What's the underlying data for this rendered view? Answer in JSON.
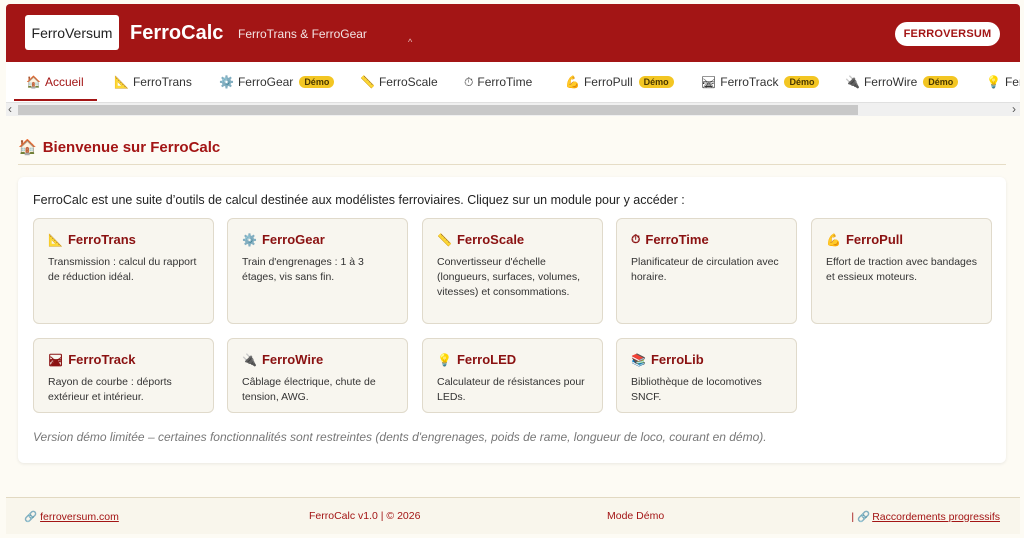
{
  "header": {
    "logo_text": "FerroVersum",
    "app_title": "FerroCalc",
    "subtitle": "FerroTrans & FerroGear",
    "caret": "^",
    "brand_button": "FERROVERSUM",
    "accent": "#a31515"
  },
  "tabs": [
    {
      "icon": "🏠",
      "icon_name": "house-icon",
      "label": "Accueil",
      "active": true,
      "badge": ""
    },
    {
      "icon": "📐",
      "icon_name": "triangle-ruler-icon",
      "label": "FerroTrans",
      "badge": ""
    },
    {
      "icon": "⚙️",
      "icon_name": "gear-icon",
      "label": "FerroGear",
      "badge": "Démo"
    },
    {
      "icon": "📏",
      "icon_name": "ruler-icon",
      "label": "FerroScale",
      "badge": ""
    },
    {
      "icon": "⏱",
      "icon_name": "stopwatch-icon",
      "label": "FerroTime",
      "badge": ""
    },
    {
      "icon": "💪",
      "icon_name": "flexed-arm-icon",
      "label": "FerroPull",
      "badge": "Démo"
    },
    {
      "icon": "🛤",
      "icon_name": "railway-track-icon",
      "label": "FerroTrack",
      "badge": "Démo"
    },
    {
      "icon": "🔌",
      "icon_name": "plug-icon",
      "label": "FerroWire",
      "badge": "Démo"
    },
    {
      "icon": "💡",
      "icon_name": "bulb-icon",
      "label": "Ferr",
      "badge": ""
    }
  ],
  "scrollbar": {
    "left_arrow": "‹",
    "right_arrow": "›"
  },
  "main": {
    "section_icon": "🏠",
    "section_title": "Bienvenue sur FerroCalc",
    "intro": "FerroCalc est une suite d’outils de calcul destinée aux modélistes ferroviaires. Cliquez sur un module pour y accéder :",
    "cards": [
      {
        "icon": "📐",
        "icon_name": "triangle-ruler-icon",
        "title": "FerroTrans",
        "desc": "Transmission : calcul du rapport de réduction idéal."
      },
      {
        "icon": "⚙️",
        "icon_name": "gear-icon",
        "title": "FerroGear",
        "desc": "Train d'engrenages : 1 à 3 étages, vis sans fin."
      },
      {
        "icon": "📏",
        "icon_name": "ruler-icon",
        "title": "FerroScale",
        "desc": "Convertisseur d'échelle (longueurs, surfaces, volumes, vitesses) et consommations."
      },
      {
        "icon": "⏱",
        "icon_name": "stopwatch-icon",
        "title": "FerroTime",
        "desc": "Planificateur de circulation avec horaire."
      },
      {
        "icon": "💪",
        "icon_name": "flexed-arm-icon",
        "title": "FerroPull",
        "desc": "Effort de traction avec bandages et essieux moteurs."
      },
      {
        "icon": "🛤",
        "icon_name": "railway-track-icon",
        "title": "FerroTrack",
        "desc": "Rayon de courbe : déports extérieur et intérieur."
      },
      {
        "icon": "🔌",
        "icon_name": "plug-icon",
        "title": "FerroWire",
        "desc": "Câblage électrique, chute de tension, AWG."
      },
      {
        "icon": "💡",
        "icon_name": "bulb-icon",
        "title": "FerroLED",
        "desc": "Calculateur de résistances pour LEDs."
      },
      {
        "icon": "📚",
        "icon_name": "books-icon",
        "title": "FerroLib",
        "desc": "Bibliothèque de locomotives SNCF."
      }
    ],
    "demo_note": "Version démo limitée – certaines fonctionnalités sont restreintes (dents d'engrenages, poids de rame, longueur de loco, courant en démo)."
  },
  "footer": {
    "link_icon": "🔗",
    "site_link": "ferroversum.com",
    "version": "FerroCalc v1.0 | © 2026",
    "mode": "Mode Démo",
    "separator": "|",
    "right_link": "Raccordements progressifs"
  }
}
